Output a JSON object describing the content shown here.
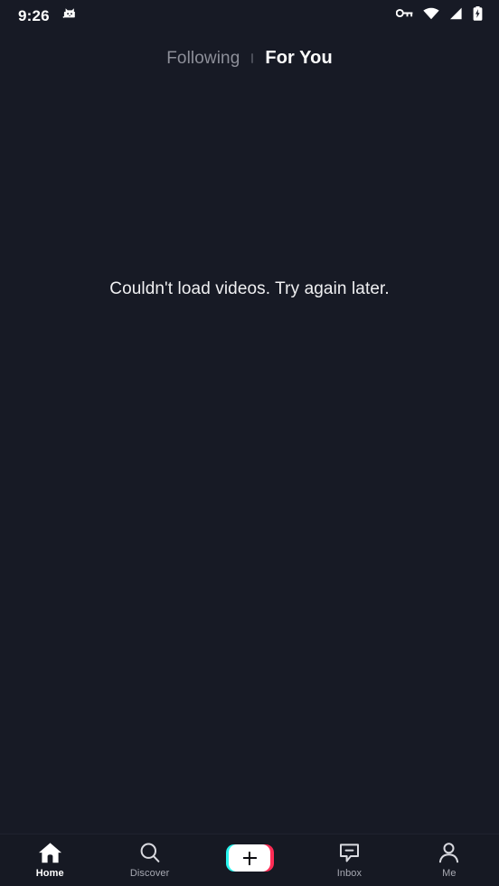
{
  "status_bar": {
    "time": "9:26",
    "notification_icon": "cat-app-notification-icon",
    "icons": [
      "vpn-key-icon",
      "wifi-icon",
      "cellular-signal-icon",
      "battery-charging-icon"
    ]
  },
  "top_tabs": {
    "separator": "·",
    "items": [
      {
        "label": "Following",
        "active": false
      },
      {
        "label": "For You",
        "active": true
      }
    ]
  },
  "feed": {
    "error_message": "Couldn't load videos. Try again later."
  },
  "bottom_nav": {
    "items": [
      {
        "label": "Home",
        "icon": "home-icon",
        "active": true
      },
      {
        "label": "Discover",
        "icon": "search-icon",
        "active": false
      },
      {
        "label": "",
        "icon": "create-plus-icon",
        "active": false
      },
      {
        "label": "Inbox",
        "icon": "inbox-icon",
        "active": false
      },
      {
        "label": "Me",
        "icon": "person-icon",
        "active": false
      }
    ]
  },
  "colors": {
    "background": "#171A25",
    "nav_background": "#161923",
    "accent_cyan": "#27F4EE",
    "accent_pink": "#FE2C55",
    "text_primary": "#FFFFFF",
    "text_muted": "#8D8F99"
  }
}
